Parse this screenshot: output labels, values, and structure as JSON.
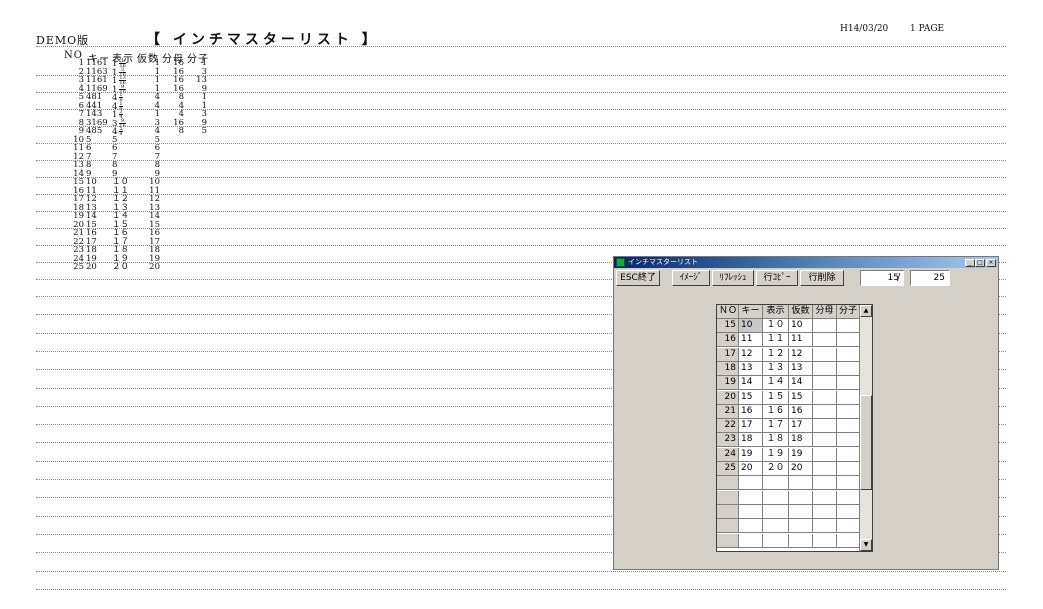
{
  "report": {
    "demo_label": "DEMO版",
    "title": "【 インチマスターリスト 】",
    "date": "H14/03/20",
    "page": "1 PAGE",
    "columns": [
      "NO",
      "キー",
      "表示",
      "仮数",
      "分母",
      "分子"
    ],
    "rows": [
      {
        "no": "1",
        "key": "1161",
        "disp": "1",
        "frac_n": "1",
        "frac_d": "16",
        "kana": "1",
        "den": "16",
        "num": "1"
      },
      {
        "no": "2",
        "key": "1163",
        "disp": "1",
        "frac_n": "3",
        "frac_d": "16",
        "kana": "1",
        "den": "16",
        "num": "3"
      },
      {
        "no": "3",
        "key": "1161",
        "disp": "1",
        "frac_n": "13",
        "frac_d": "16",
        "kana": "1",
        "den": "16",
        "num": "13"
      },
      {
        "no": "4",
        "key": "1169",
        "disp": "1",
        "frac_n": "9",
        "frac_d": "16",
        "kana": "1",
        "den": "16",
        "num": "9"
      },
      {
        "no": "5",
        "key": "481",
        "disp": "4",
        "frac_n": "1",
        "frac_d": "8",
        "kana": "4",
        "den": "8",
        "num": "1"
      },
      {
        "no": "6",
        "key": "441",
        "disp": "4",
        "frac_n": "1",
        "frac_d": "4",
        "kana": "4",
        "den": "4",
        "num": "1"
      },
      {
        "no": "7",
        "key": "143",
        "disp": "1",
        "frac_n": "3",
        "frac_d": "4",
        "kana": "1",
        "den": "4",
        "num": "3"
      },
      {
        "no": "8",
        "key": "3169",
        "disp": "3",
        "frac_n": "9",
        "frac_d": "16",
        "kana": "3",
        "den": "16",
        "num": "9"
      },
      {
        "no": "9",
        "key": "485",
        "disp": "4",
        "frac_n": "5",
        "frac_d": "8",
        "kana": "4",
        "den": "8",
        "num": "5"
      },
      {
        "no": "10",
        "key": "5",
        "disp": "5",
        "frac_n": "",
        "frac_d": "",
        "kana": "5",
        "den": "",
        "num": ""
      },
      {
        "no": "11",
        "key": "6",
        "disp": "6",
        "frac_n": "",
        "frac_d": "",
        "kana": "6",
        "den": "",
        "num": ""
      },
      {
        "no": "12",
        "key": "7",
        "disp": "7",
        "frac_n": "",
        "frac_d": "",
        "kana": "7",
        "den": "",
        "num": ""
      },
      {
        "no": "13",
        "key": "8",
        "disp": "8",
        "frac_n": "",
        "frac_d": "",
        "kana": "8",
        "den": "",
        "num": ""
      },
      {
        "no": "14",
        "key": "9",
        "disp": "9",
        "frac_n": "",
        "frac_d": "",
        "kana": "9",
        "den": "",
        "num": ""
      },
      {
        "no": "15",
        "key": "10",
        "disp": "１０",
        "frac_n": "",
        "frac_d": "",
        "kana": "10",
        "den": "",
        "num": ""
      },
      {
        "no": "16",
        "key": "11",
        "disp": "１１",
        "frac_n": "",
        "frac_d": "",
        "kana": "11",
        "den": "",
        "num": ""
      },
      {
        "no": "17",
        "key": "12",
        "disp": "１２",
        "frac_n": "",
        "frac_d": "",
        "kana": "12",
        "den": "",
        "num": ""
      },
      {
        "no": "18",
        "key": "13",
        "disp": "１３",
        "frac_n": "",
        "frac_d": "",
        "kana": "13",
        "den": "",
        "num": ""
      },
      {
        "no": "19",
        "key": "14",
        "disp": "１４",
        "frac_n": "",
        "frac_d": "",
        "kana": "14",
        "den": "",
        "num": ""
      },
      {
        "no": "20",
        "key": "15",
        "disp": "１５",
        "frac_n": "",
        "frac_d": "",
        "kana": "15",
        "den": "",
        "num": ""
      },
      {
        "no": "21",
        "key": "16",
        "disp": "１６",
        "frac_n": "",
        "frac_d": "",
        "kana": "16",
        "den": "",
        "num": ""
      },
      {
        "no": "22",
        "key": "17",
        "disp": "１７",
        "frac_n": "",
        "frac_d": "",
        "kana": "17",
        "den": "",
        "num": ""
      },
      {
        "no": "23",
        "key": "18",
        "disp": "１８",
        "frac_n": "",
        "frac_d": "",
        "kana": "18",
        "den": "",
        "num": ""
      },
      {
        "no": "24",
        "key": "19",
        "disp": "１９",
        "frac_n": "",
        "frac_d": "",
        "kana": "19",
        "den": "",
        "num": ""
      },
      {
        "no": "25",
        "key": "20",
        "disp": "２０",
        "frac_n": "",
        "frac_d": "",
        "kana": "20",
        "den": "",
        "num": ""
      }
    ]
  },
  "window": {
    "title": "インチマスターリスト",
    "buttons": {
      "esc": "ESC終了",
      "image": "ｲﾒｰｼﾞ",
      "refresh": "ﾘﾌﾚｯｼｭ",
      "copy": "行ｺﾋﾟｰ",
      "delete": "行削除"
    },
    "counter_current": "15",
    "counter_total": "25",
    "grid": {
      "columns": [
        "ＮＯ",
        "キー",
        "表示",
        "仮数",
        "分母",
        "分子"
      ],
      "rows": [
        {
          "no": "15",
          "key": "10",
          "disp": "１０",
          "kana": "10",
          "den": "",
          "num": ""
        },
        {
          "no": "16",
          "key": "11",
          "disp": "１１",
          "kana": "11",
          "den": "",
          "num": ""
        },
        {
          "no": "17",
          "key": "12",
          "disp": "１２",
          "kana": "12",
          "den": "",
          "num": ""
        },
        {
          "no": "18",
          "key": "13",
          "disp": "１３",
          "kana": "13",
          "den": "",
          "num": ""
        },
        {
          "no": "19",
          "key": "14",
          "disp": "１４",
          "kana": "14",
          "den": "",
          "num": ""
        },
        {
          "no": "20",
          "key": "15",
          "disp": "１５",
          "kana": "15",
          "den": "",
          "num": ""
        },
        {
          "no": "21",
          "key": "16",
          "disp": "１６",
          "kana": "16",
          "den": "",
          "num": ""
        },
        {
          "no": "22",
          "key": "17",
          "disp": "１７",
          "kana": "17",
          "den": "",
          "num": ""
        },
        {
          "no": "23",
          "key": "18",
          "disp": "１８",
          "kana": "18",
          "den": "",
          "num": ""
        },
        {
          "no": "24",
          "key": "19",
          "disp": "１９",
          "kana": "19",
          "den": "",
          "num": ""
        },
        {
          "no": "25",
          "key": "20",
          "disp": "２０",
          "kana": "20",
          "den": "",
          "num": ""
        }
      ],
      "empty_rows": 5
    }
  }
}
